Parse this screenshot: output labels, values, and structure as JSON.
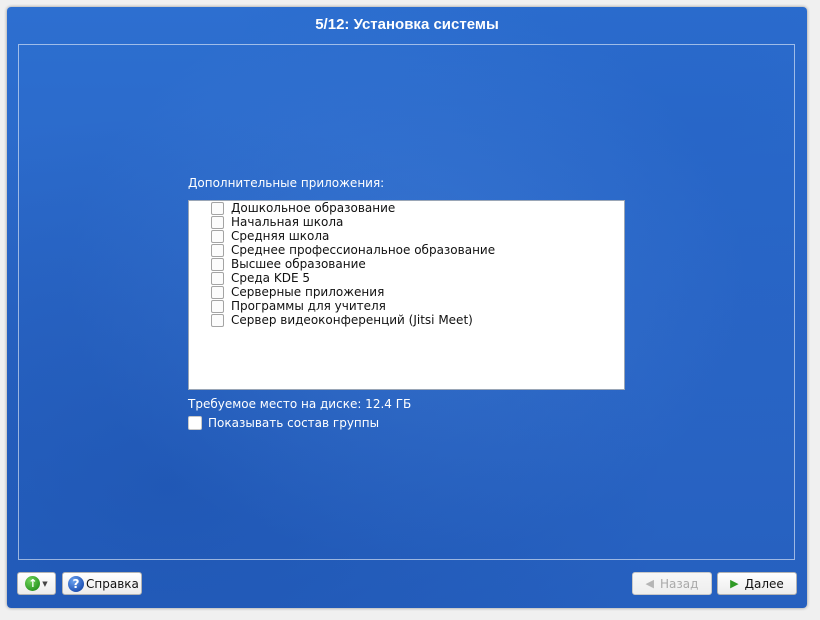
{
  "window": {
    "title": "5/12: Установка системы"
  },
  "main": {
    "section_label": "Дополнительные приложения:",
    "items": [
      {
        "label": "Дошкольное образование",
        "checked": false
      },
      {
        "label": "Начальная школа",
        "checked": false
      },
      {
        "label": "Средняя школа",
        "checked": false
      },
      {
        "label": "Среднее профессиональное образование",
        "checked": false
      },
      {
        "label": "Высшее образование",
        "checked": false
      },
      {
        "label": "Среда KDE 5",
        "checked": false
      },
      {
        "label": "Серверные приложения",
        "checked": false
      },
      {
        "label": "Программы для учителя",
        "checked": false
      },
      {
        "label": "Сервер видеоконференций (Jitsi Meet)",
        "checked": false
      }
    ],
    "disk_space": "Требуемое место на диске: 12.4 ГБ",
    "show_group": {
      "label": "Показывать состав группы",
      "checked": false
    }
  },
  "footer": {
    "up_icon": "arrow-up-icon",
    "help_label": "Справка",
    "help_icon": "help-icon",
    "back_label": "Назад",
    "back_disabled": true,
    "next_label": "Далее"
  },
  "colors": {
    "background": "#2a66c6",
    "accent_green": "#2f9a25"
  }
}
